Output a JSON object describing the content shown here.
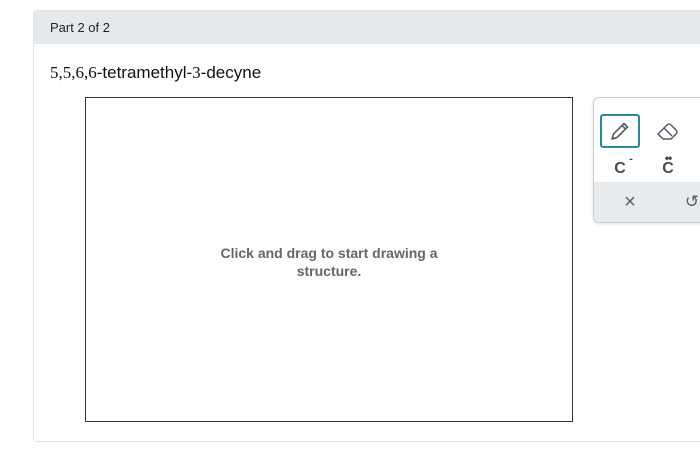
{
  "part": {
    "label": "Part 2 of 2"
  },
  "question": {
    "prefix_numbers": "5,5,6,6",
    "middle": "-tetramethyl-",
    "position_number": "3",
    "suffix": "-decyne"
  },
  "canvas": {
    "hint_line1": "Click and drag to start drawing a",
    "hint_line2": "structure."
  },
  "toolbar": {
    "tools": [
      {
        "icon": "pencil-icon",
        "selected": true
      },
      {
        "icon": "eraser-icon",
        "selected": false
      },
      {
        "label": "C",
        "charge": "-",
        "icon": "carbanion-icon"
      },
      {
        "label": "C",
        "dots": "••",
        "icon": "lone-pair-icon"
      }
    ],
    "footer": [
      {
        "icon": "close-icon",
        "glyph": "×"
      },
      {
        "icon": "undo-icon",
        "glyph": "↺"
      }
    ]
  },
  "colors": {
    "header_bg": "#e6e9ec",
    "selected_border": "#2a8a9c",
    "hint_text": "#666666"
  }
}
